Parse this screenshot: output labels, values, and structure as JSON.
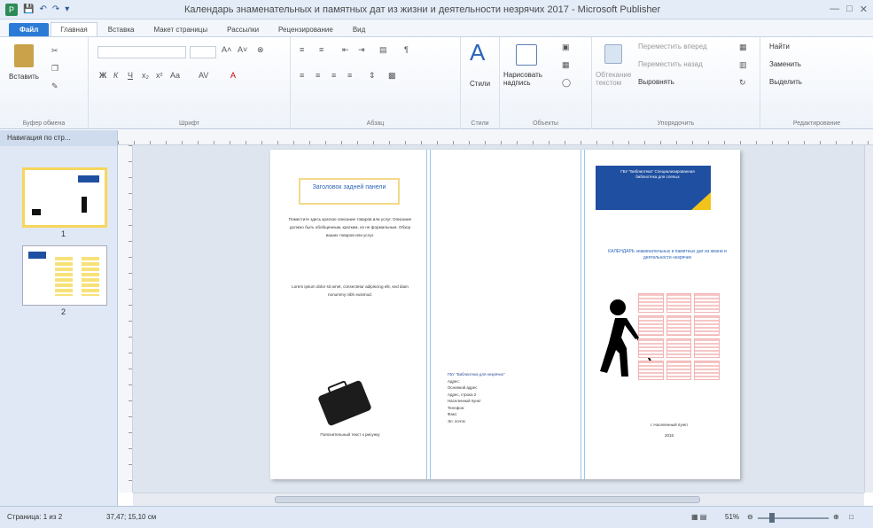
{
  "window": {
    "title": "Календарь знаменательных и памятных дат из жизни и деятельности незрячих 2017 - Microsoft Publisher",
    "app_icon": "publisher-icon",
    "qat_icons": [
      "save-icon",
      "undo-icon",
      "redo-icon",
      "customize-icon"
    ],
    "controls": [
      "minimize-icon",
      "restore-icon",
      "close-icon"
    ]
  },
  "ribbon": {
    "tabs": [
      {
        "label": "Файл"
      },
      {
        "label": "Главная"
      },
      {
        "label": "Вставка"
      },
      {
        "label": "Макет страницы"
      },
      {
        "label": "Рассылки"
      },
      {
        "label": "Рецензирование"
      },
      {
        "label": "Вид"
      }
    ],
    "groups": {
      "clipboard": {
        "label": "Буфер обмена",
        "paste": "Вставить"
      },
      "font": {
        "label": "Шрифт"
      },
      "paragraph": {
        "label": "Абзац"
      },
      "styles": {
        "label": "Стили",
        "button": "Стили"
      },
      "objects": {
        "label": "Объекты",
        "draw_textbox": "Нарисовать надпись"
      },
      "arrange": {
        "label": "Упорядочить",
        "wrap_text": "Обтекание текстом",
        "bring_forward": "Переместить вперед",
        "send_backward": "Переместить назад",
        "align": "Выровнять"
      },
      "editing": {
        "label": "Редактирование",
        "find": "Найти",
        "replace": "Заменить",
        "select": "Выделить"
      }
    }
  },
  "nav": {
    "title": "Навигация по стр...",
    "pages": [
      {
        "num": "1"
      },
      {
        "num": "2"
      }
    ]
  },
  "document": {
    "left_panel": {
      "heading": "Заголовок задней панели",
      "body1": "Поместите здесь краткое описание товаров или услуг. Описание должно быть обобщенным, кратким, но не формальным. Обзор ваших товаров или услуг.",
      "body2": "Lorem ipsum dolor sit amet, consectetur adipiscing elit, sed diam nonummy nibh euismod.",
      "caption": "Пояснительный текст к рисунку"
    },
    "middle_panel": {
      "org": "ГБУ \"Библиотека для незрячих\"",
      "lines": [
        "Адрес:",
        "Основной адрес",
        "Адрес, строка 2",
        "Населенный пункт",
        "Телефон:",
        "Факс:",
        "Эл. почта:"
      ]
    },
    "right_panel": {
      "banner": "ГБУ \"Библиотека\" Специализированная библиотека для слепых",
      "cal_title": "КАЛЕНДАРЬ знаменательных и памятных дат из жизни и деятельности незрячих",
      "city": "г. Населенный пункт",
      "year": "2016"
    }
  },
  "status": {
    "page": "Страница: 1 из 2",
    "position": "37,47; 15,10 см",
    "zoom": "51%"
  },
  "colors": {
    "banner_blue": "#1f4fa0",
    "banner_yellow": "#f0c419",
    "file_tab": "#2b7bd6",
    "link_blue": "#2a64b8"
  }
}
